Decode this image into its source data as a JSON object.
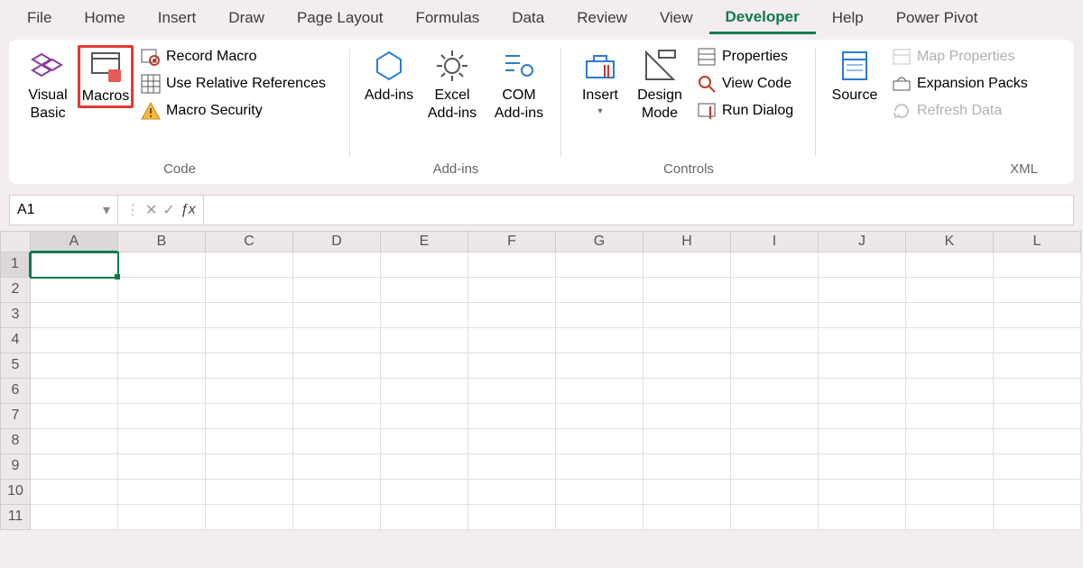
{
  "tabs": [
    "File",
    "Home",
    "Insert",
    "Draw",
    "Page Layout",
    "Formulas",
    "Data",
    "Review",
    "View",
    "Developer",
    "Help",
    "Power Pivot"
  ],
  "active_tab": "Developer",
  "ribbon": {
    "code": {
      "visual_basic": "Visual Basic",
      "macros": "Macros",
      "record_macro": "Record Macro",
      "use_relative": "Use Relative References",
      "macro_security": "Macro Security",
      "group": "Code"
    },
    "addins": {
      "addins": "Add-ins",
      "excel_addins": "Excel Add-ins",
      "com_addins": "COM Add-ins",
      "group": "Add-ins"
    },
    "controls": {
      "insert": "Insert",
      "design_mode": "Design Mode",
      "properties": "Properties",
      "view_code": "View Code",
      "run_dialog": "Run Dialog",
      "group": "Controls"
    },
    "xml": {
      "source": "Source",
      "map_properties": "Map Properties",
      "expansion_packs": "Expansion Packs",
      "refresh_data": "Refresh Data",
      "group": "XML"
    }
  },
  "namebox": "A1",
  "formula": "",
  "columns": [
    "A",
    "B",
    "C",
    "D",
    "E",
    "F",
    "G",
    "H",
    "I",
    "J",
    "K",
    "L"
  ],
  "rows": [
    "1",
    "2",
    "3",
    "4",
    "5",
    "6",
    "7",
    "8",
    "9",
    "10",
    "11"
  ],
  "active_cell": {
    "col": 0,
    "row": 0
  }
}
